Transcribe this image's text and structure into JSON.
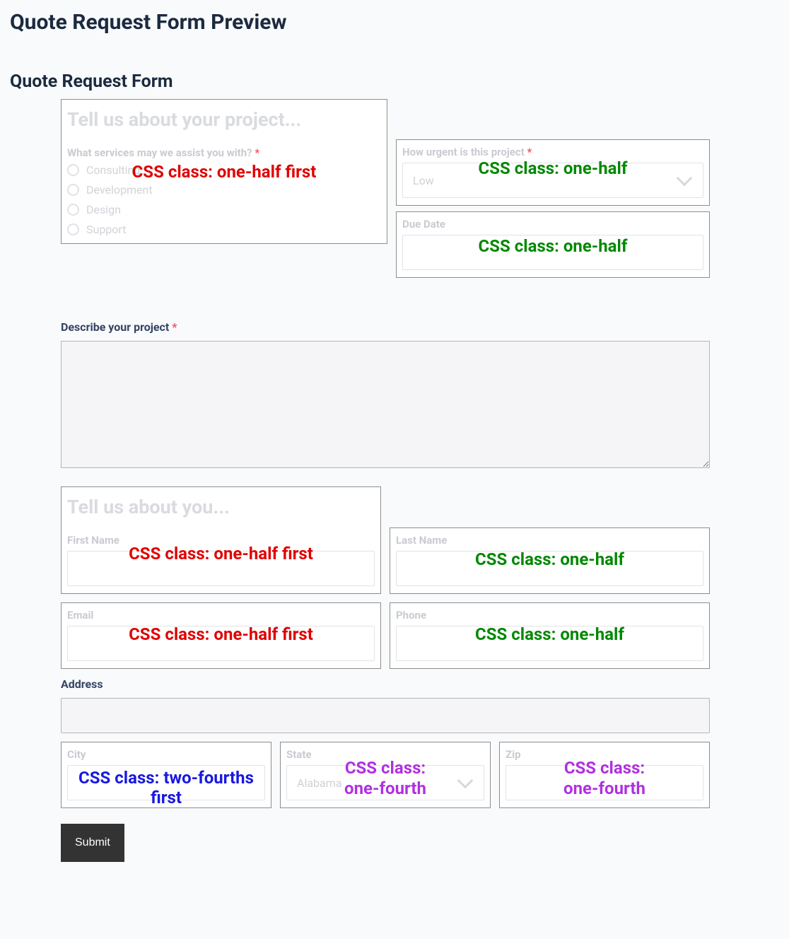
{
  "page_title": "Quote Request Form Preview",
  "form_title": "Quote Request Form",
  "sections": {
    "project_heading": "Tell us about your project...",
    "about_heading": "Tell us about you..."
  },
  "overlays": {
    "one_half_first": "CSS class: one-half first",
    "one_half": "CSS class: one-half",
    "two_fourths_first": "CSS class: two-fourths first",
    "one_fourth": "CSS class:\none-fourth"
  },
  "services": {
    "label": "What services may we assist you with? ",
    "required": "*",
    "options": [
      "Consulting",
      "Development",
      "Design",
      "Support"
    ]
  },
  "urgency": {
    "label": "How urgent is this project ",
    "required": "*",
    "value": "Low"
  },
  "due_date": {
    "label": "Due Date"
  },
  "describe": {
    "label": "Describe your project ",
    "required": "*"
  },
  "first_name": {
    "label": "First Name"
  },
  "last_name": {
    "label": "Last Name"
  },
  "email": {
    "label": "Email"
  },
  "phone": {
    "label": "Phone"
  },
  "address": {
    "label": "Address"
  },
  "city": {
    "label": "City"
  },
  "state": {
    "label": "State",
    "value": "Alabama"
  },
  "zip": {
    "label": "Zip"
  },
  "submit": {
    "label": "Submit"
  }
}
